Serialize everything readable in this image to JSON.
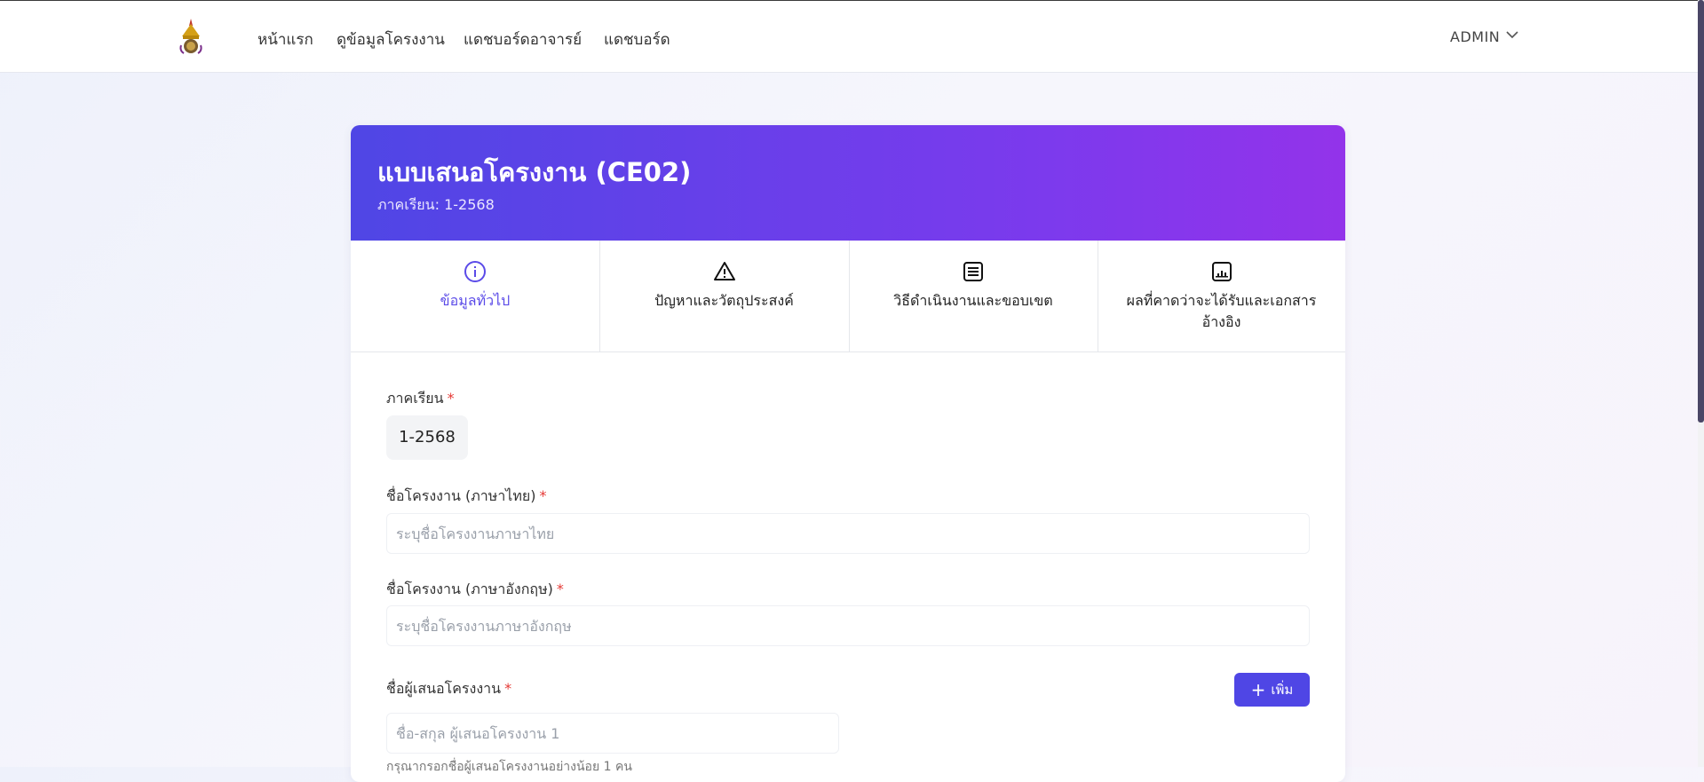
{
  "nav": {
    "items": [
      {
        "label": "หน้าแรก"
      },
      {
        "label": "ดูข้อมูลโครงงาน"
      },
      {
        "label": "แดชบอร์ดอาจารย์"
      },
      {
        "label": "แดชบอร์ด"
      }
    ],
    "user": "ADMIN"
  },
  "hero": {
    "title": "แบบเสนอโครงงาน (CE02)",
    "subtitle": "ภาคเรียน: 1-2568"
  },
  "tabs": [
    {
      "label": "ข้อมูลทั่วไป",
      "icon": "info-icon",
      "active": true
    },
    {
      "label": "ปัญหาและวัตถุประสงค์",
      "icon": "warning-icon",
      "active": false
    },
    {
      "label": "วิธีดำเนินงานและขอบเขต",
      "icon": "document-icon",
      "active": false
    },
    {
      "label": "ผลที่คาดว่าจะได้รับและเอกสารอ้างอิง",
      "icon": "chart-icon",
      "active": false
    }
  ],
  "form": {
    "semester": {
      "label": "ภาคเรียน",
      "value": "1-2568"
    },
    "name_th": {
      "label": "ชื่อโครงงาน (ภาษาไทย)",
      "placeholder": "ระบุชื่อโครงงานภาษาไทย",
      "value": ""
    },
    "name_en": {
      "label": "ชื่อโครงงาน (ภาษาอังกฤษ)",
      "placeholder": "ระบุชื่อโครงงานภาษาอังกฤษ",
      "value": ""
    },
    "proposers": {
      "label": "ชื่อผู้เสนอโครงงาน",
      "add_label": "เพิ่ม",
      "placeholder": "ชื่อ-สกุล ผู้เสนอโครงงาน 1",
      "value": "",
      "helper": "กรุณากรอกชื่อผู้เสนอโครงงานอย่างน้อย 1 คน"
    },
    "required_mark": "*"
  },
  "colors": {
    "accent": "#4f46e5",
    "accent_end": "#9333ea",
    "required": "#e53935"
  }
}
